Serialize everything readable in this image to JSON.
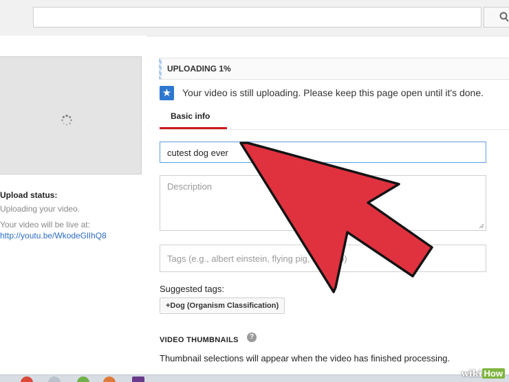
{
  "search": {
    "value": "",
    "icon": "search-icon"
  },
  "sidebar": {
    "upload_status_label": "Upload status:",
    "upload_status_text": "Uploading your video.",
    "live_at_text": "Your video will be live at:",
    "video_link": "http://youtu.be/WkodeGlIhQ8"
  },
  "upload": {
    "progress_label": "UPLOADING 1%",
    "progress_percent": 1,
    "info_message": "Your video is still uploading. Please keep this page open until it's done."
  },
  "tabs": {
    "basic_info": "Basic info"
  },
  "form": {
    "title_value": "cutest dog ever",
    "description_placeholder": "Description",
    "tags_placeholder": "Tags (e.g., albert einstein, flying pig, mashup)",
    "suggested_tags_label": "Suggested tags:",
    "suggested_tags": [
      "+Dog (Organism Classification)"
    ]
  },
  "thumbnails": {
    "label": "VIDEO THUMBNAILS",
    "note": "Thumbnail selections will appear when the video has finished processing."
  },
  "watermark": {
    "part1": "wiki",
    "part2": "How"
  },
  "colors": {
    "accent_red": "#cc181e",
    "arrow_red": "#e0313f",
    "link_blue": "#2b6cc5",
    "info_blue": "#2f78d0"
  }
}
